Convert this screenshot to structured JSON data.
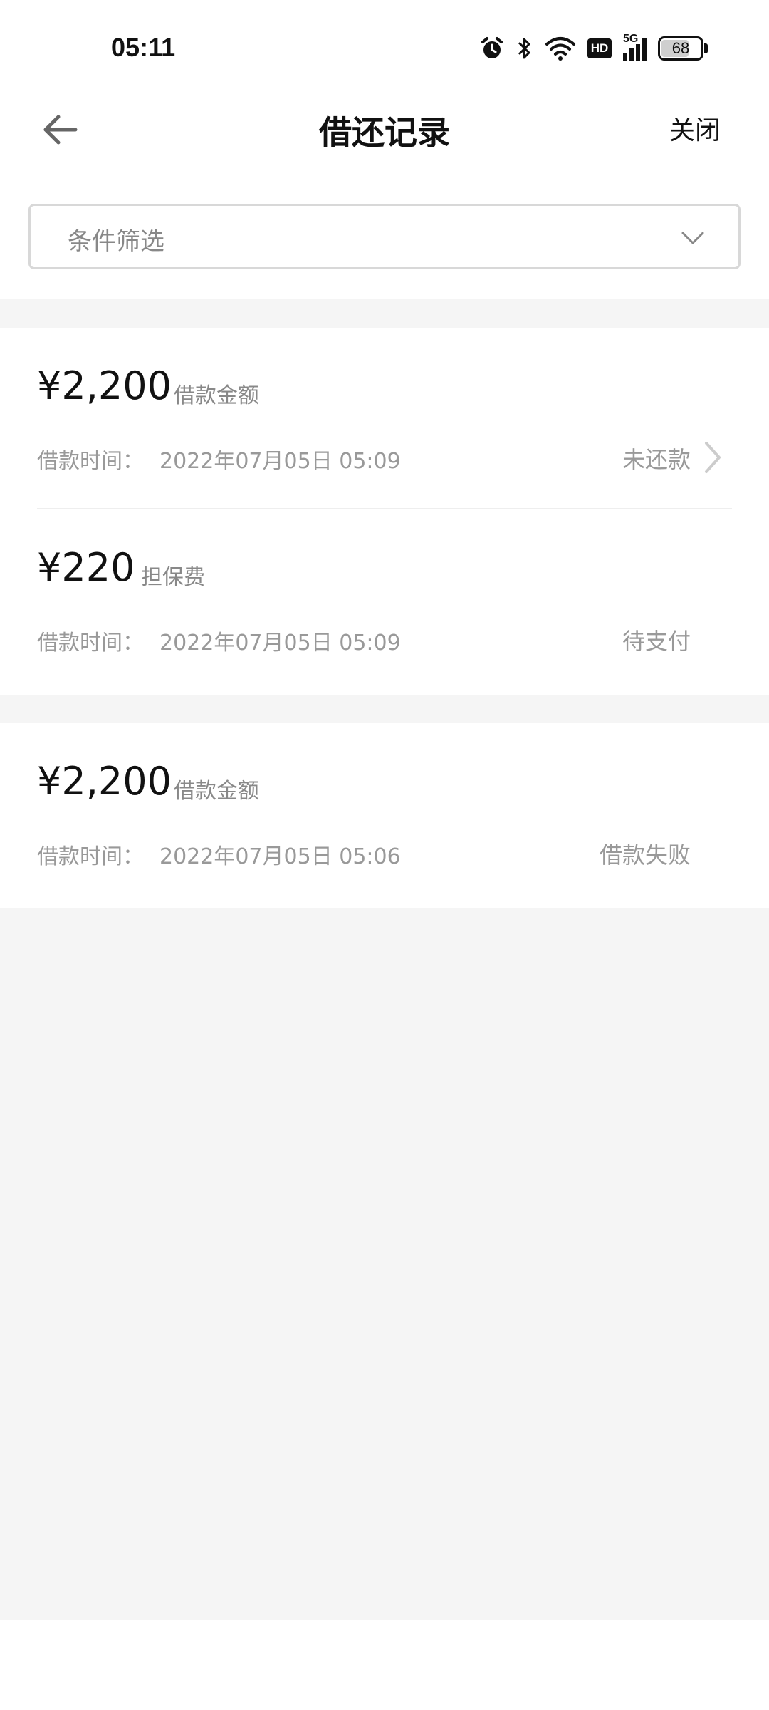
{
  "status_bar": {
    "time": "05:11",
    "icons": [
      "alarm-icon",
      "bluetooth-icon",
      "wifi-icon",
      "hd-icon",
      "signal-5g-icon",
      "battery-icon"
    ],
    "hd_label": "HD",
    "network_label": "5G",
    "battery_level": "68"
  },
  "header": {
    "back_icon": "arrow-left-icon",
    "title": "借还记录",
    "close_label": "关闭"
  },
  "filter": {
    "label": "条件筛选",
    "icon": "chevron-down-icon"
  },
  "records": [
    {
      "amount": "¥2,200",
      "type": "借款金额",
      "time_label": "借款时间：",
      "time_value": "2022年07月05日 05:09",
      "status": "未还款",
      "has_chevron": true
    },
    {
      "amount": "¥220",
      "type": "担保费",
      "time_label": "借款时间：",
      "time_value": "2022年07月05日 05:09",
      "status": "待支付",
      "has_chevron": false
    },
    {
      "amount": "¥2,200",
      "type": "借款金额",
      "time_label": "借款时间：",
      "time_value": "2022年07月05日 05:06",
      "status": "借款失败",
      "has_chevron": false
    }
  ],
  "colors": {
    "text_primary": "#111111",
    "text_secondary": "#888888",
    "text_tertiary": "#999999",
    "background_gray": "#f5f5f5",
    "border": "#d8d8d8"
  }
}
